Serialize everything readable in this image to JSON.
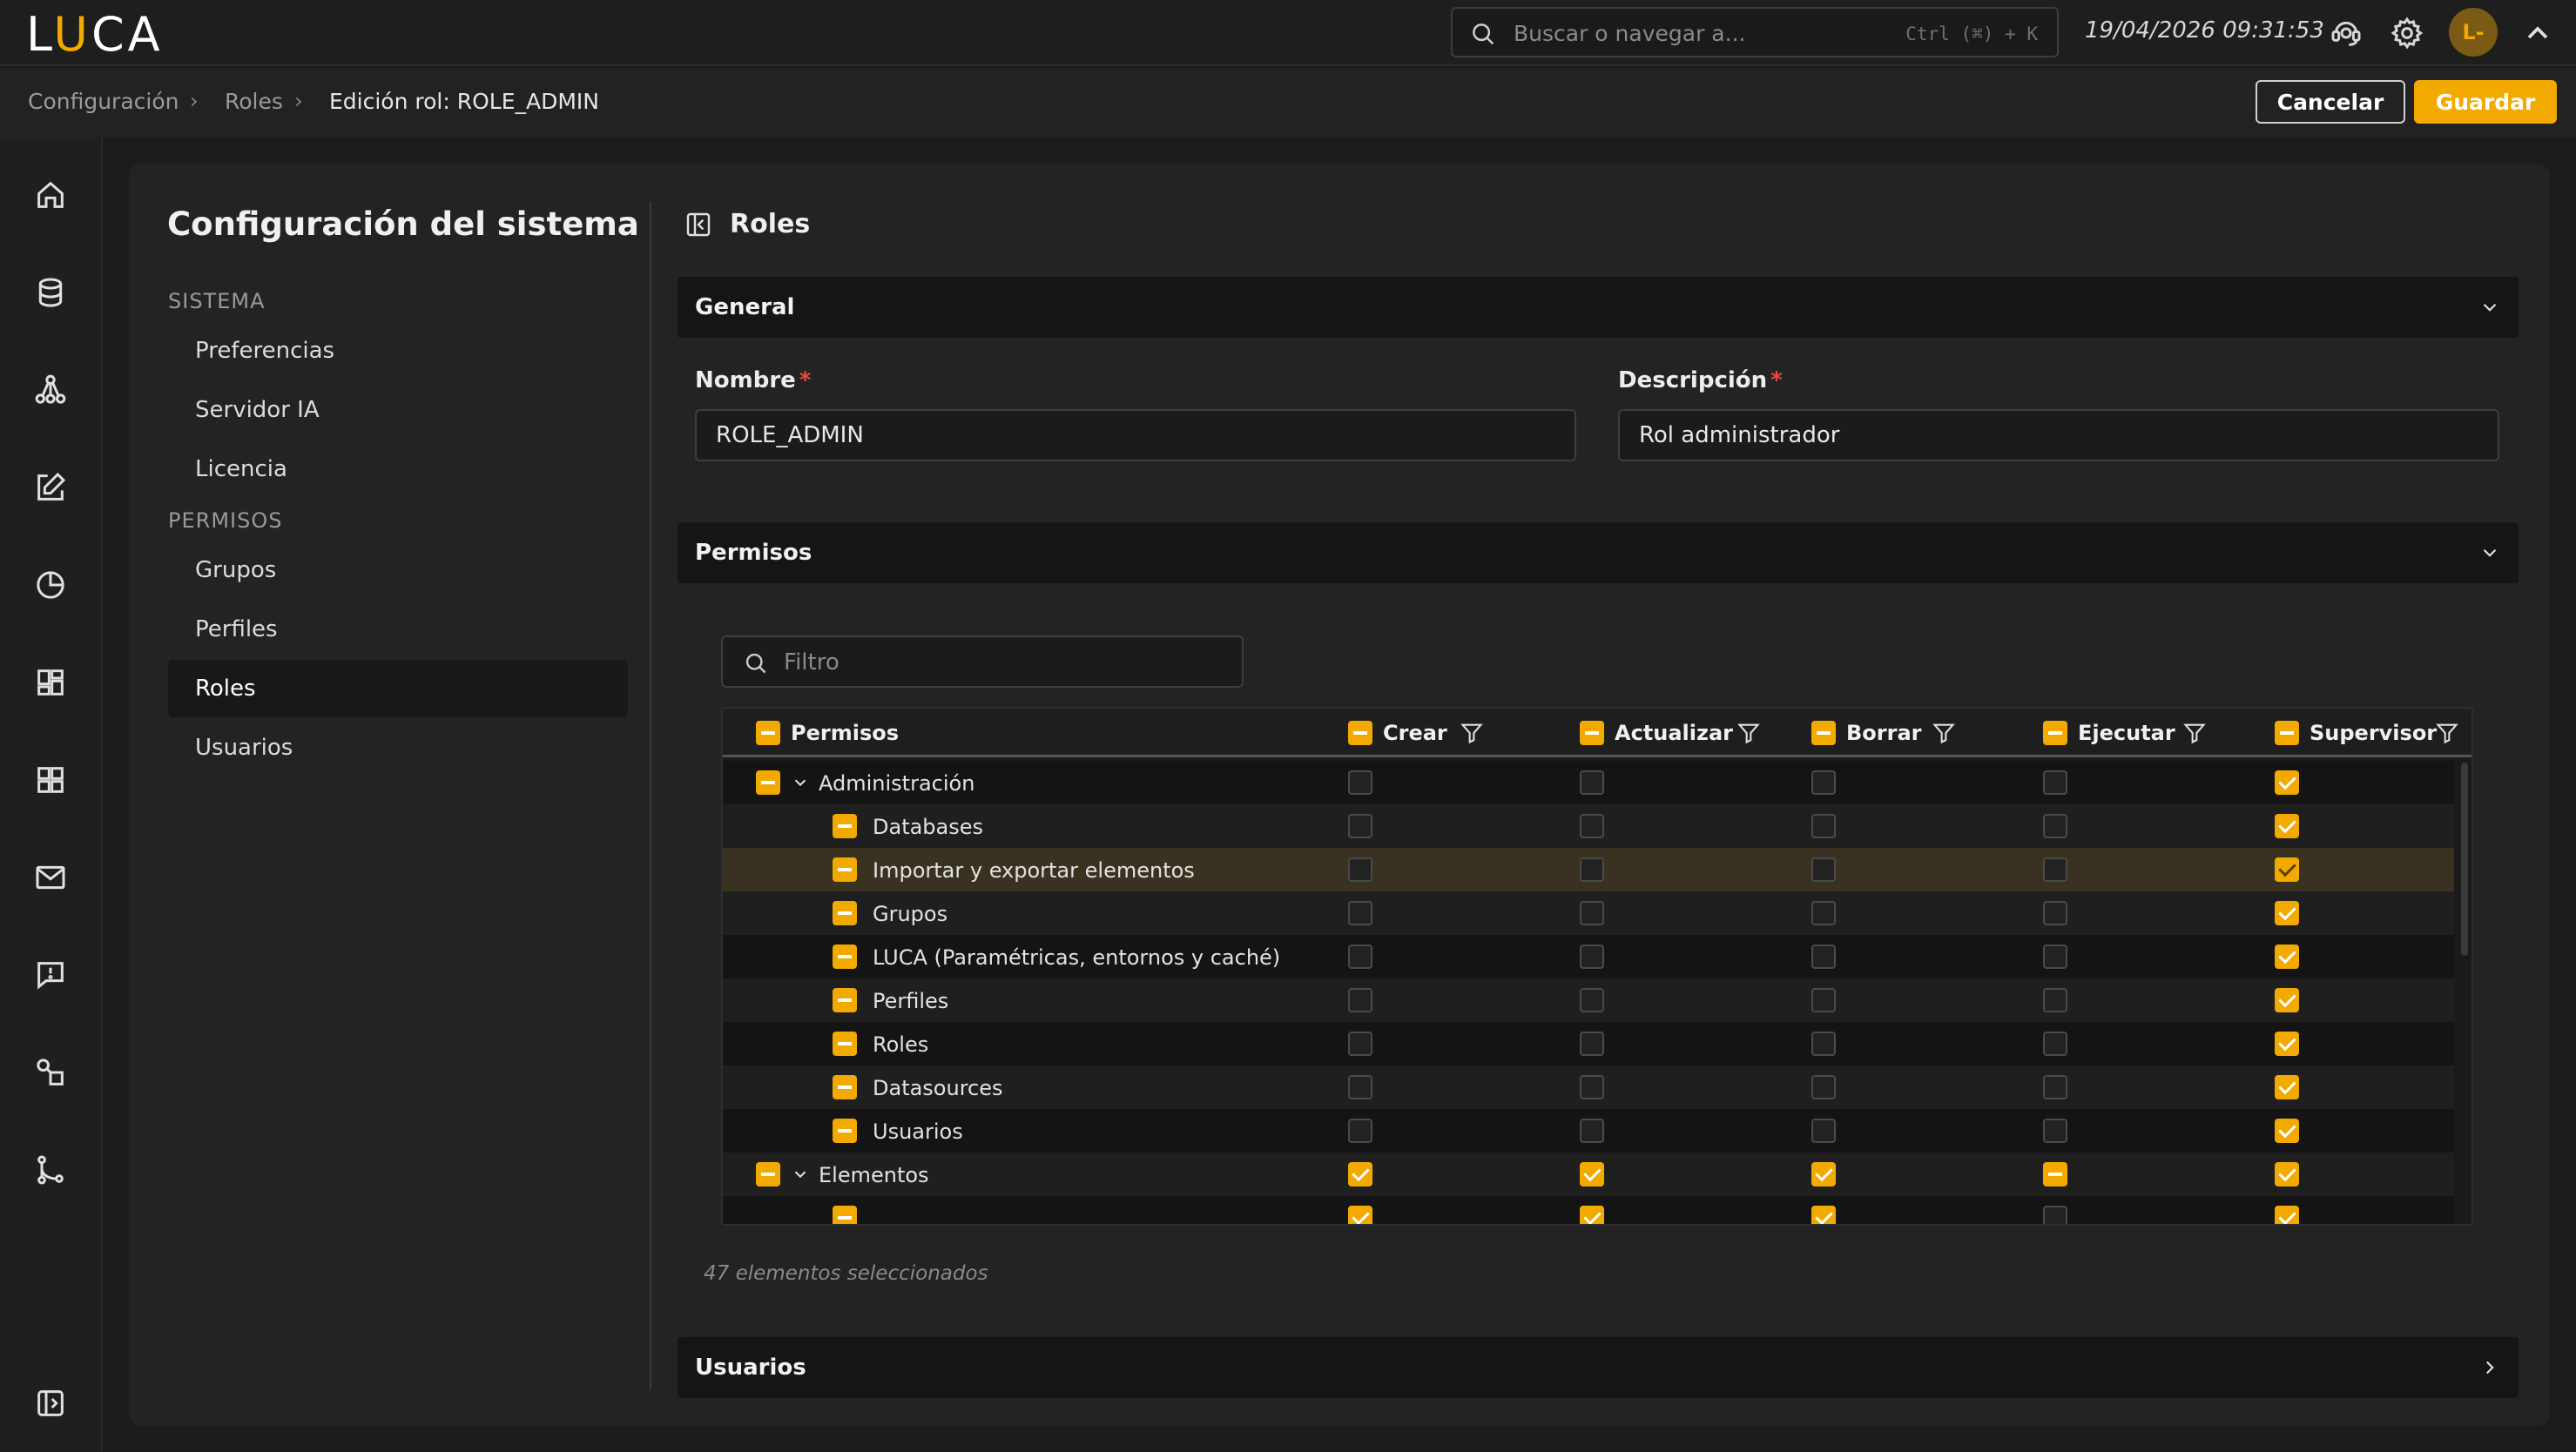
{
  "app": {
    "logo": {
      "l": "L",
      "u": "U",
      "rest": "CA"
    },
    "search_placeholder": "Buscar o navegar a...",
    "search_shortcut": "Ctrl (⌘) + K",
    "datetime": "19/04/2026 09:31:53",
    "avatar": "L-"
  },
  "breadcrumb": {
    "items": [
      "Configuración",
      "Roles"
    ],
    "current": "Edición rol: ROLE_ADMIN"
  },
  "actions": {
    "cancel": "Cancelar",
    "save": "Guardar"
  },
  "sidenav": {
    "title": "Configuración del sistema",
    "sections": [
      {
        "label": "SISTEMA",
        "items": [
          "Preferencias",
          "Servidor IA",
          "Licencia"
        ]
      },
      {
        "label": "PERMISOS",
        "items": [
          "Grupos",
          "Perfiles",
          "Roles",
          "Usuarios"
        ]
      }
    ],
    "active": "Roles"
  },
  "main": {
    "title": "Roles",
    "general": {
      "label": "General",
      "nombre_label": "Nombre",
      "nombre_value": "ROLE_ADMIN",
      "descripcion_label": "Descripción",
      "descripcion_value": "Rol administrador"
    },
    "permisos": {
      "label": "Permisos",
      "filter_placeholder": "Filtro",
      "columns": [
        "Permisos",
        "Crear",
        "Actualizar",
        "Borrar",
        "Ejecutar",
        "Supervisor"
      ],
      "rows": [
        {
          "name": "Administración",
          "level": 0,
          "expanded": true,
          "row_state": "ind",
          "checks": [
            "off",
            "off",
            "off",
            "off",
            "on"
          ]
        },
        {
          "name": "Databases",
          "level": 1,
          "row_state": "ind",
          "checks": [
            "off",
            "off",
            "off",
            "off",
            "on"
          ]
        },
        {
          "name": "Importar y exportar elementos",
          "level": 1,
          "row_state": "ind",
          "hover": true,
          "checks": [
            "off",
            "off",
            "off",
            "off",
            "on"
          ]
        },
        {
          "name": "Grupos",
          "level": 1,
          "row_state": "ind",
          "checks": [
            "off",
            "off",
            "off",
            "off",
            "on"
          ]
        },
        {
          "name": "LUCA (Paramétricas, entornos y caché)",
          "level": 1,
          "row_state": "ind",
          "checks": [
            "off",
            "off",
            "off",
            "off",
            "on"
          ]
        },
        {
          "name": "Perfiles",
          "level": 1,
          "row_state": "ind",
          "checks": [
            "off",
            "off",
            "off",
            "off",
            "on"
          ]
        },
        {
          "name": "Roles",
          "level": 1,
          "row_state": "ind",
          "checks": [
            "off",
            "off",
            "off",
            "off",
            "on"
          ]
        },
        {
          "name": "Datasources",
          "level": 1,
          "row_state": "ind",
          "checks": [
            "off",
            "off",
            "off",
            "off",
            "on"
          ]
        },
        {
          "name": "Usuarios",
          "level": 1,
          "row_state": "ind",
          "checks": [
            "off",
            "off",
            "off",
            "off",
            "on"
          ]
        },
        {
          "name": "Elementos",
          "level": 0,
          "expanded": true,
          "row_state": "ind",
          "checks": [
            "on",
            "on",
            "on",
            "ind",
            "on"
          ]
        },
        {
          "name": "",
          "level": 1,
          "row_state": "ind",
          "checks": [
            "on",
            "on",
            "on",
            "off",
            "on"
          ]
        }
      ],
      "selected_count": "47 elementos seleccionados"
    },
    "usuarios": {
      "label": "Usuarios"
    }
  },
  "colors": {
    "accent": "#f2a900",
    "bg": "#1c1c1c",
    "panel": "#232323"
  }
}
